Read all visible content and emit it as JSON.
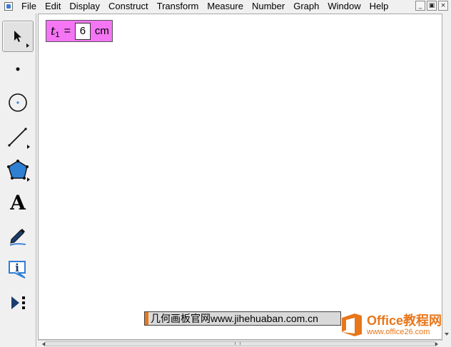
{
  "menu": {
    "items": [
      "File",
      "Edit",
      "Display",
      "Construct",
      "Transform",
      "Measure",
      "Number",
      "Graph",
      "Window",
      "Help"
    ]
  },
  "window_controls": {
    "minimize": "_",
    "restore": "▣",
    "close": "×"
  },
  "toolbar": {
    "tools": [
      "arrow-select-tool",
      "point-tool",
      "compass-tool",
      "straightedge-tool",
      "polygon-tool",
      "text-tool",
      "marker-tool",
      "information-tool",
      "custom-tools"
    ],
    "text_tool_glyph": "A",
    "info_tool_glyph": "i"
  },
  "parameter": {
    "variable": "t",
    "subscript": "1",
    "equals": "=",
    "value": "6",
    "unit": "cm",
    "background": "#f476f4"
  },
  "watermark": {
    "text": "几何画板官网www.jihehuaban.com.cn"
  },
  "office_logo": {
    "name": "Office教程网",
    "url": "www.office26.com",
    "color": "#e8761a"
  }
}
